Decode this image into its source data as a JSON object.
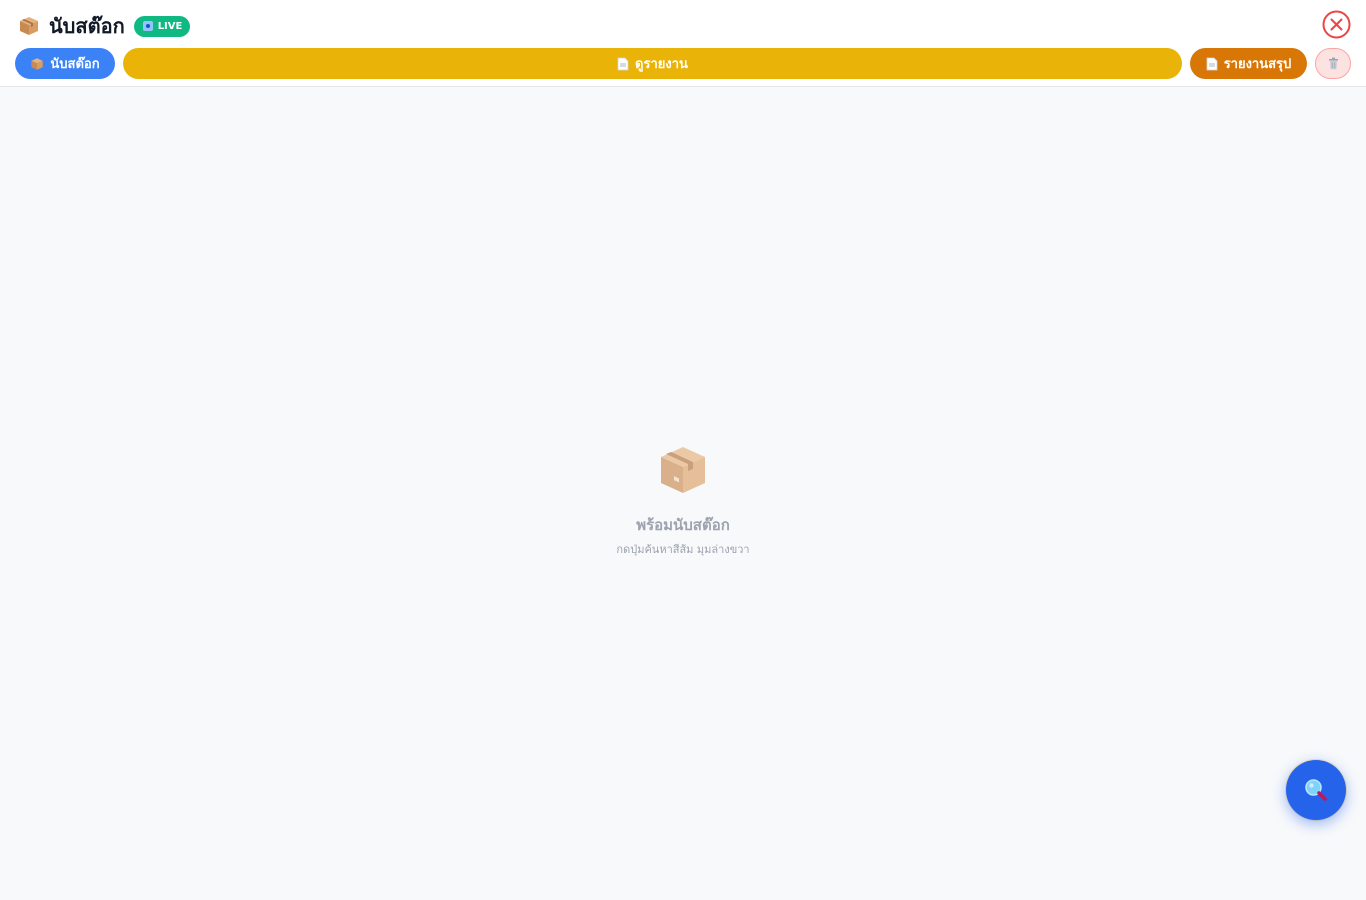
{
  "header": {
    "title": "นับสต๊อก",
    "live_label": "LIVE",
    "title_icon": "package-icon",
    "close_icon": "close-icon"
  },
  "toolbar": {
    "count_label": "นับสต๊อก",
    "view_report_label": "ดูรายงาน",
    "summary_label": "รายงานสรุป",
    "trash_icon": "trash-icon"
  },
  "empty_state": {
    "title": "พร้อมนับสต๊อก",
    "subtitle": "กดปุ่มค้นหาสีส้ม มุมล่างขวา",
    "icon": "package-icon"
  },
  "fab": {
    "icon": "search-icon"
  },
  "colors": {
    "count_button": "#3b82f6",
    "view_button": "#eab308",
    "summary_button": "#d97706",
    "live_badge": "#10b981",
    "close": "#ef4444",
    "fab": "#2563eb"
  }
}
